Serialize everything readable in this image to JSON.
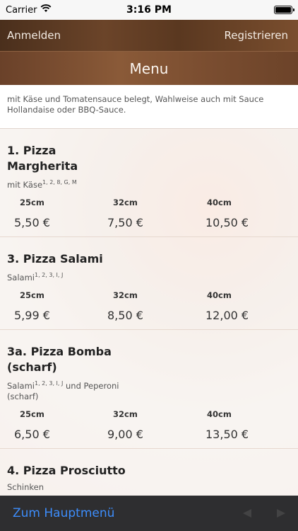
{
  "status": {
    "carrier": "Carrier",
    "time": "3:16 PM"
  },
  "nav": {
    "login": "Anmelden",
    "register": "Registrieren"
  },
  "title": "Menu",
  "intro": "mit Käse und Tomatensauce belegt, Wahlweise auch mit Sauce Hollandaise oder BBQ-Sauce.",
  "sizes": [
    "25cm",
    "32cm",
    "40cm"
  ],
  "items": [
    {
      "name": "1. Pizza Margherita",
      "desc": "mit Käse",
      "sup": "1, 2, 8, G, M",
      "desc2": "",
      "prices": [
        "5,50 €",
        "7,50 €",
        "10,50 €"
      ]
    },
    {
      "name": "3. Pizza Salami",
      "desc": "Salami",
      "sup": "1, 2, 3, I, J",
      "desc2": "",
      "prices": [
        "5,99 €",
        "8,50 €",
        "12,00 €"
      ]
    },
    {
      "name": "3a. Pizza Bomba (scharf)",
      "desc": "Salami",
      "sup": "1, 2, 3, I, J",
      "desc2": " und Peperoni (scharf)",
      "prices": [
        "6,50 €",
        "9,00 €",
        "13,50 €"
      ]
    },
    {
      "name": "4. Pizza Prosciutto",
      "desc": "Schinken",
      "sup": "",
      "desc2": "",
      "prices": [
        "",
        "",
        ""
      ]
    }
  ],
  "toolbar": {
    "main_menu": "Zum Hauptmenü"
  },
  "colors": {
    "nav_brown": "#5a3820",
    "link_blue": "#3d8dfb",
    "toolbar_bg": "#2e2e30"
  },
  "icons": {
    "wifi": "wifi-icon",
    "battery": "battery-icon",
    "back": "back-arrow-icon",
    "forward": "forward-arrow-icon"
  }
}
